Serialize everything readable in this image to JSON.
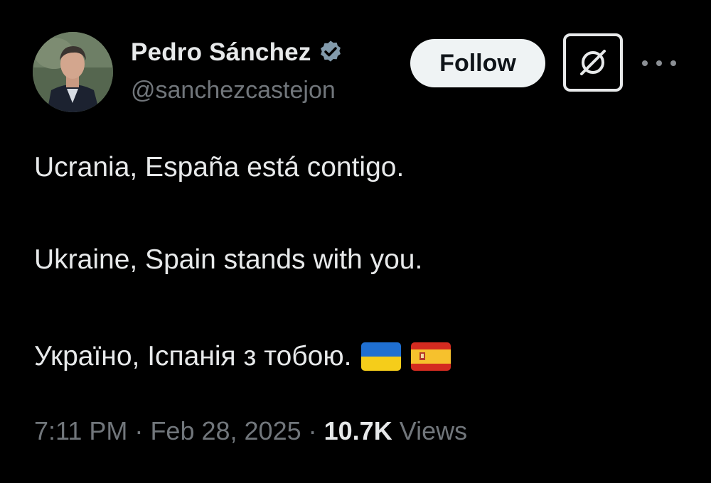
{
  "author": {
    "display_name": "Pedro Sánchez",
    "handle": "@sanchezcastejon",
    "verified_color": "#829aab"
  },
  "actions": {
    "follow_label": "Follow",
    "grok_icon": "grok-icon",
    "more_icon": "more-options-icon"
  },
  "tweet": {
    "lines": [
      "Ucrania, España está contigo.",
      "Ukraine, Spain stands with you.",
      "Україно, Іспанія з тобою."
    ],
    "emojis": [
      "ukraine-flag-icon",
      "spain-flag-icon"
    ]
  },
  "meta": {
    "time": "7:11 PM",
    "separator": "·",
    "date": "Feb 28, 2025",
    "views_count": "10.7K",
    "views_label": "Views"
  },
  "colors": {
    "background": "#000000",
    "text_primary": "#e7e9ea",
    "text_secondary": "#71767b",
    "follow_bg": "#eff3f4"
  }
}
